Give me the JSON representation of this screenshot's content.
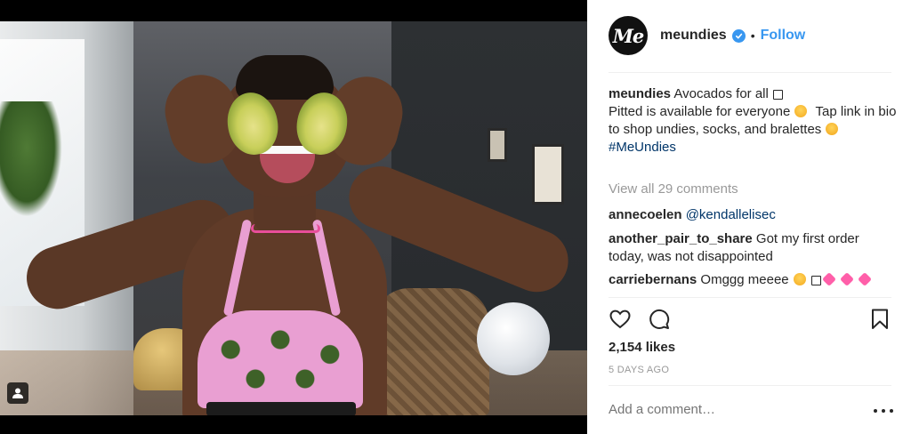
{
  "post": {
    "username": "meundies",
    "avatar_text": "Me",
    "follow_label": "Follow",
    "separator": "•"
  },
  "caption": {
    "username": "meundies",
    "line1": "Avocados for all",
    "line2": "Pitted is available for everyone",
    "line3": "Tap link in bio to shop undies, socks, and bralettes",
    "hashtag": "#MeUndies"
  },
  "comments_link": "View all 29 comments",
  "comments": [
    {
      "user": "annecoelen",
      "text": "@kendallelisec"
    },
    {
      "user": "another_pair_to_share",
      "text": "Got my first order today, was not disappointed"
    },
    {
      "user": "carriebernans",
      "text": "Omggg meeee"
    }
  ],
  "likes": "2,154 likes",
  "time_ago": "5 DAYS AGO",
  "add_comment_placeholder": "Add a comment…",
  "colors": {
    "accent": "#3897f0",
    "text": "#262626",
    "muted": "#999999",
    "link": "#003569"
  },
  "icons": [
    "user-tag-icon",
    "verified-badge-icon",
    "heart-icon",
    "comment-icon",
    "bookmark-icon",
    "more-options-icon"
  ]
}
